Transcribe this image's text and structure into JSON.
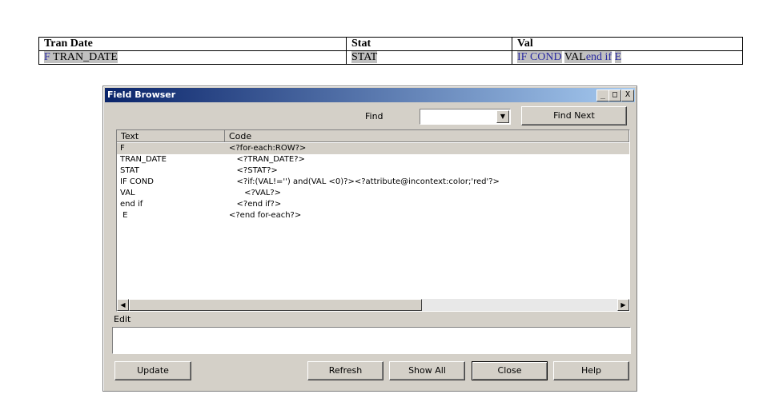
{
  "template_table": {
    "headers": [
      "Tran Date",
      "Stat",
      "Val"
    ],
    "row": {
      "tran_date": {
        "f": "F",
        "field": "TRAN_DATE"
      },
      "stat": "STAT",
      "val": {
        "if_cond": "IF COND",
        "val": "VAL",
        "end_if": "end if",
        "e": "E"
      }
    }
  },
  "dialog": {
    "title": "Field Browser",
    "find_label": "Find",
    "find_value": "",
    "find_next": "Find Next",
    "columns": [
      "Text",
      "Code"
    ],
    "rows": [
      {
        "text": "F",
        "code": "<?for-each:ROW?>"
      },
      {
        "text": "TRAN_DATE",
        "code": "   <?TRAN_DATE?>"
      },
      {
        "text": "STAT",
        "code": "   <?STAT?>"
      },
      {
        "text": "IF COND",
        "code": "   <?if:(VAL!='') and(VAL <0)?><?attribute@incontext:color;'red'?>"
      },
      {
        "text": "VAL",
        "code": "      <?VAL?>"
      },
      {
        "text": "end if",
        "code": "   <?end if?>"
      },
      {
        "text": " E",
        "code": "<?end for-each?>"
      }
    ],
    "edit_label": "Edit",
    "edit_value": "",
    "buttons": {
      "update": "Update",
      "refresh": "Refresh",
      "show_all": "Show All",
      "close": "Close",
      "help": "Help"
    },
    "window_controls": {
      "minimize": "_",
      "maximize": "□",
      "close": "X"
    }
  }
}
